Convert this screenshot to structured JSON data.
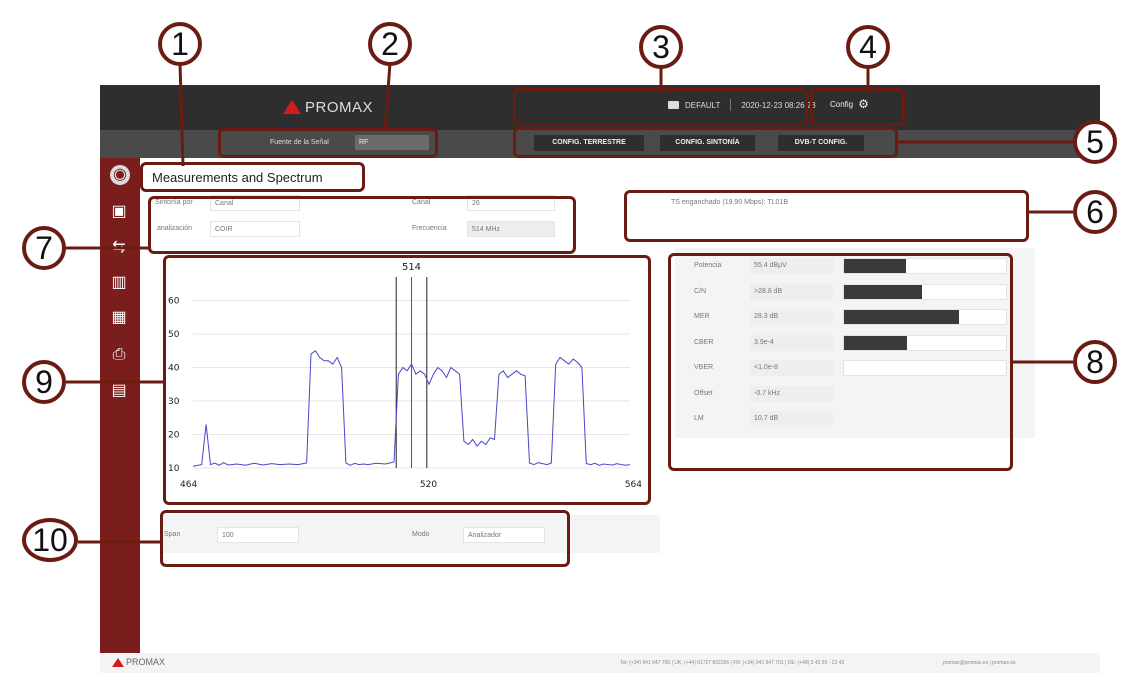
{
  "header": {
    "logo": "PROMAX",
    "preset": "DEFAULT",
    "datetime": "2020-12-23 08:26:23",
    "config_label": "Config",
    "signal_source_label": "Fuente de la Señal",
    "signal_source_value": "RF",
    "buttons": [
      "CONFIG. TERRESTRE",
      "CONFIG. SINTONÍA",
      "DVB-T CONFIG."
    ]
  },
  "page_title": "Measurements and Spectrum",
  "tuning": {
    "sintonia_label": "Sintonía por",
    "sintonia_value": "Canal",
    "canal_label": "Canal",
    "canal_value": "26",
    "analizacion_label": "analización",
    "analizacion_value": "COIR",
    "frecuencia_label": "Frecuencia",
    "frecuencia_value": "514 MHz"
  },
  "ts_status": "TS enganchado (19.90 Mbps): TL01B",
  "measurements": [
    {
      "label": "Potencia",
      "value": "55.4 dBµV",
      "level": 0.38
    },
    {
      "label": "C/N",
      "value": ">28.8 dB",
      "level": 0.48
    },
    {
      "label": "MER",
      "value": "28.3 dB",
      "level": 0.71
    },
    {
      "label": "CBER",
      "value": "3.9e-4",
      "level": 0.39
    },
    {
      "label": "VBER",
      "value": "<1.0e-8",
      "level": 0
    },
    {
      "label": "Offset",
      "value": "-0.7 kHz"
    },
    {
      "label": "LM",
      "value": "10.7 dB"
    }
  ],
  "spectrum_controls": {
    "span_label": "Span",
    "span_value": "100",
    "modo_label": "Modo",
    "modo_value": "Analizador"
  },
  "callouts": [
    "1",
    "2",
    "3",
    "4",
    "5",
    "6",
    "7",
    "8",
    "9",
    "10"
  ],
  "footer": {
    "logo": "PROMAX",
    "contacts": "Tel: (+34) 941 647 700  |  UK: (+44) 01727 832266  |  FR: (+34) 941 647 701  |  DE: (+49) 3 42 55 - 22 42",
    "email": "promax@promax.es  |  promax.es"
  },
  "colors": {
    "sidebar": "#7a1d1d",
    "header": "#2e2e2e",
    "callout": "#6b1c12",
    "spectrum_trace": "#4747c8",
    "marker": "#e02020"
  },
  "chart_data": {
    "type": "line",
    "title": "",
    "xlabel": "",
    "ylabel": "",
    "marker_label": "514",
    "x_ticks": [
      464,
      520,
      564
    ],
    "y_ticks": [
      10,
      20,
      30,
      40,
      50,
      60
    ],
    "xlim": [
      464,
      564
    ],
    "ylim": [
      10,
      67
    ],
    "markers": {
      "center": 514,
      "band_edges": [
        510.5,
        517.5
      ]
    },
    "series": [
      {
        "x": [
          464,
          466,
          467,
          468,
          469,
          470,
          471,
          472,
          474,
          476,
          478,
          480,
          482,
          484,
          486,
          488,
          490,
          491,
          492,
          493,
          494,
          495,
          496,
          497,
          498,
          499,
          500,
          501,
          502,
          503,
          504,
          506,
          508,
          510,
          511,
          512,
          513,
          514,
          515,
          516,
          517,
          518,
          519,
          520,
          521,
          522,
          523,
          524,
          525,
          526,
          527,
          528,
          529,
          530,
          531,
          532,
          533,
          534,
          535,
          536,
          537,
          538,
          539,
          540,
          541,
          542,
          543,
          544,
          545,
          546,
          547,
          548,
          549,
          550,
          551,
          552,
          553,
          554,
          555,
          556,
          557,
          558,
          559,
          560,
          561,
          562,
          563,
          564
        ],
        "y": [
          10.5,
          11,
          23,
          11,
          11.5,
          10.8,
          11.6,
          10.9,
          11.2,
          10.8,
          11.4,
          10.9,
          11.3,
          11.0,
          11.2,
          11.0,
          11.5,
          44,
          45,
          43,
          42,
          42,
          41,
          43,
          40,
          11.5,
          10.8,
          11.4,
          11.0,
          11.2,
          11.0,
          11.4,
          11.2,
          11.8,
          38,
          40,
          39,
          41,
          38,
          39,
          38,
          35,
          38,
          40,
          39,
          37,
          40,
          39,
          38,
          18,
          17,
          18.5,
          16.5,
          18,
          17,
          19,
          18.5,
          38,
          39,
          37,
          38,
          39,
          38,
          37.5,
          11.5,
          11.0,
          11.6,
          11.3,
          11.0,
          11.5,
          41,
          43,
          42,
          41,
          42.5,
          41.5,
          40,
          11.3,
          11.0,
          11.4,
          10.8,
          11.2,
          11.0,
          10.9,
          11.3,
          11.0,
          10.8,
          11.0
        ]
      }
    ]
  }
}
